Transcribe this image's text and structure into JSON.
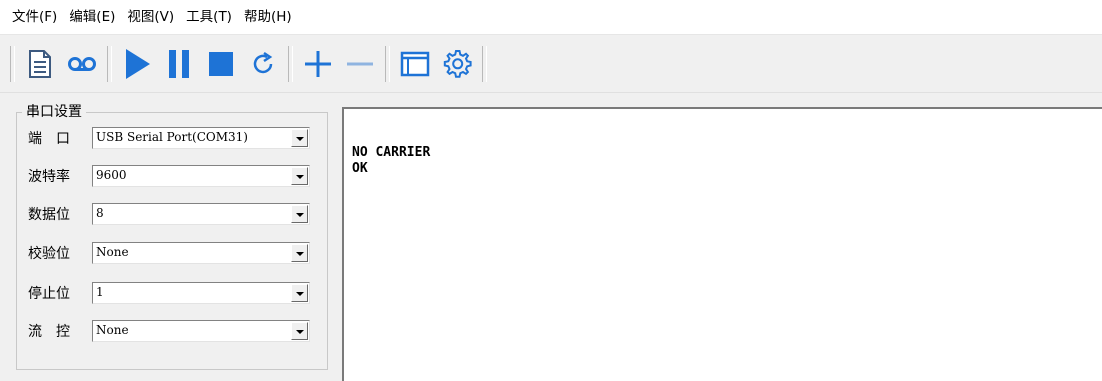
{
  "menu": [
    "文件(F)",
    "编辑(E)",
    "视图(V)",
    "工具(T)",
    "帮助(H)"
  ],
  "toolbar": {
    "buttons": [
      {
        "name": "document-icon",
        "color": "#3d5a80"
      },
      {
        "name": "tape-icon",
        "color": "#1e73d6"
      },
      {
        "name": "play-icon",
        "color": "#1e73d6"
      },
      {
        "name": "pause-icon",
        "color": "#1e73d6"
      },
      {
        "name": "stop-icon",
        "color": "#1e73d6"
      },
      {
        "name": "refresh-icon",
        "color": "#1e73d6"
      },
      {
        "name": "plus-icon",
        "color": "#1e73d6"
      },
      {
        "name": "minus-icon",
        "color": "#1e73d6"
      },
      {
        "name": "window-icon",
        "color": "#1e73d6"
      },
      {
        "name": "gear-icon",
        "color": "#1e73d6"
      }
    ]
  },
  "settings": {
    "title": "串口设置",
    "rows": [
      {
        "label": "端　口",
        "value": "USB Serial Port(COM31)"
      },
      {
        "label": "波特率",
        "value": "9600"
      },
      {
        "label": "数据位",
        "value": "8"
      },
      {
        "label": "校验位",
        "value": "None"
      },
      {
        "label": "停止位",
        "value": "1"
      },
      {
        "label": "流　控",
        "value": "None"
      }
    ]
  },
  "terminal": {
    "lines": [
      "NO CARRIER",
      "OK"
    ]
  }
}
